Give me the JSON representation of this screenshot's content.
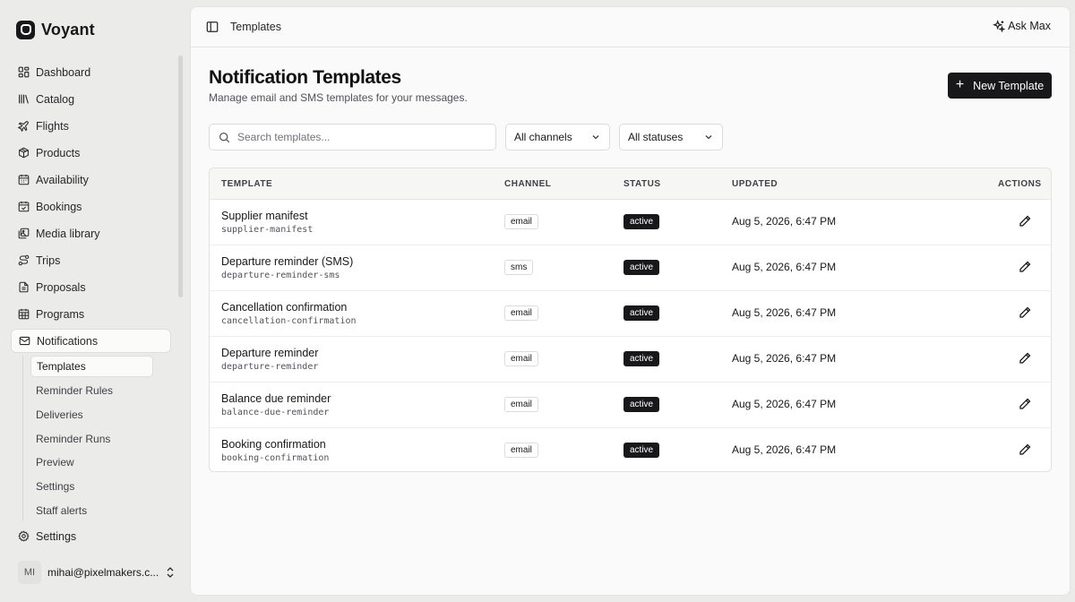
{
  "brand": {
    "name": "Voyant"
  },
  "sidebar": {
    "items": [
      {
        "label": "Dashboard",
        "icon": "dashboard-icon"
      },
      {
        "label": "Catalog",
        "icon": "library-icon"
      },
      {
        "label": "Flights",
        "icon": "plane-icon"
      },
      {
        "label": "Products",
        "icon": "package-icon"
      },
      {
        "label": "Availability",
        "icon": "calendar-icon"
      },
      {
        "label": "Bookings",
        "icon": "calendar-check-icon"
      },
      {
        "label": "Media library",
        "icon": "images-icon"
      },
      {
        "label": "Trips",
        "icon": "route-icon"
      },
      {
        "label": "Proposals",
        "icon": "file-icon"
      },
      {
        "label": "Programs",
        "icon": "calendar-grid-icon"
      },
      {
        "label": "Notifications",
        "icon": "mail-icon",
        "active": true
      }
    ],
    "subitems": [
      {
        "label": "Templates",
        "active": true
      },
      {
        "label": "Reminder Rules"
      },
      {
        "label": "Deliveries"
      },
      {
        "label": "Reminder Runs"
      },
      {
        "label": "Preview"
      },
      {
        "label": "Settings"
      },
      {
        "label": "Staff alerts"
      }
    ],
    "settings_label": "Settings",
    "user": {
      "initials": "MI",
      "email": "mihai@pixelmakers.c..."
    }
  },
  "topbar": {
    "breadcrumb": "Templates",
    "ask_label": "Ask Max"
  },
  "page": {
    "title": "Notification Templates",
    "subtitle": "Manage email and SMS templates for your messages.",
    "new_button_label": "New Template"
  },
  "filters": {
    "search_placeholder": "Search templates...",
    "channel_value": "All channels",
    "status_value": "All statuses"
  },
  "table": {
    "headers": {
      "template": "TEMPLATE",
      "channel": "CHANNEL",
      "status": "STATUS",
      "updated": "UPDATED",
      "actions": "ACTIONS"
    },
    "rows": [
      {
        "name": "Supplier manifest",
        "key": "supplier-manifest",
        "channel": "email",
        "status": "active",
        "updated": "Aug 5, 2026, 6:47 PM"
      },
      {
        "name": "Departure reminder (SMS)",
        "key": "departure-reminder-sms",
        "channel": "sms",
        "status": "active",
        "updated": "Aug 5, 2026, 6:47 PM"
      },
      {
        "name": "Cancellation confirmation",
        "key": "cancellation-confirmation",
        "channel": "email",
        "status": "active",
        "updated": "Aug 5, 2026, 6:47 PM"
      },
      {
        "name": "Departure reminder",
        "key": "departure-reminder",
        "channel": "email",
        "status": "active",
        "updated": "Aug 5, 2026, 6:47 PM"
      },
      {
        "name": "Balance due reminder",
        "key": "balance-due-reminder",
        "channel": "email",
        "status": "active",
        "updated": "Aug 5, 2026, 6:47 PM"
      },
      {
        "name": "Booking confirmation",
        "key": "booking-confirmation",
        "channel": "email",
        "status": "active",
        "updated": "Aug 5, 2026, 6:47 PM"
      }
    ]
  },
  "colors": {
    "accent": "#18181b",
    "background": "#ebebea",
    "panel": "#fafafa"
  }
}
